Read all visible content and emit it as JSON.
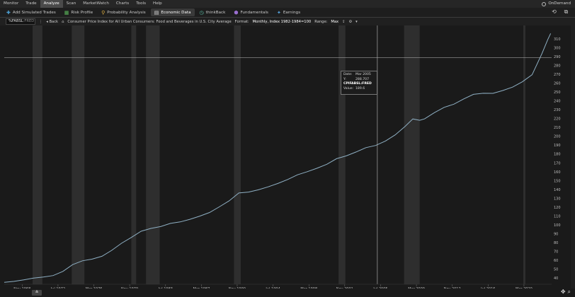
{
  "menu": {
    "items": [
      "Monitor",
      "Trade",
      "Analyze",
      "Scan",
      "MarketWatch",
      "Charts",
      "Tools",
      "Help"
    ],
    "active_index": 2,
    "ondemand_label": "OnDemand"
  },
  "tools": {
    "items": [
      {
        "label": "Add Simulated Trades",
        "icon": "plus-icon"
      },
      {
        "label": "Risk Profile",
        "icon": "risk-profile-icon"
      },
      {
        "label": "Probability Analysis",
        "icon": "probability-icon"
      },
      {
        "label": "Economic Data",
        "icon": "economic-data-icon"
      },
      {
        "label": "thinkBack",
        "icon": "thinkback-icon"
      },
      {
        "label": "Fundamentals",
        "icon": "fundamentals-icon"
      },
      {
        "label": "Earnings",
        "icon": "earnings-icon"
      }
    ],
    "active_index": 3
  },
  "chart_toolbar": {
    "symbol": "%FABSL",
    "symbol_suffix": ":FRED",
    "back_label": "Back",
    "series_title": "Consumer Price Index for All Urban Consumers: Food and Beverages in U.S. City Average",
    "format_label": "Format:",
    "format_value": "Monthly, Index 1982-1984=100",
    "range_label": "Range:",
    "range_value": "Max"
  },
  "tooltip": {
    "date_label": "Date:",
    "date_value": "Mar 2005",
    "y_label": "Y:",
    "y_value": "288.707",
    "symbol": "CPIFABSL:FRED",
    "value_label": "Value:",
    "value_value": "189.6"
  },
  "chart_data": {
    "type": "line",
    "title": "",
    "x_tick_labels": [
      "Nov 1968",
      "Jul 1972",
      "Mar 1976",
      "Nov 1979",
      "Jul 1983",
      "Mar 1987",
      "Nov 1990",
      "Jul 1994",
      "Mar 1998",
      "Nov 2001",
      "Jul 2005",
      "Mar 2009",
      "Nov 2012",
      "Jul 2016",
      "Mar 2020"
    ],
    "y_tick_labels": [
      40,
      50,
      60,
      70,
      80,
      90,
      100,
      110,
      120,
      130,
      140,
      150,
      160,
      170,
      180,
      190,
      200,
      210,
      220,
      230,
      240,
      250,
      260,
      270,
      280,
      290,
      300,
      310
    ],
    "ylim": [
      33,
      325
    ],
    "xlim": [
      1967.0,
      2023.0
    ],
    "crosshair": {
      "x": 2005.17,
      "y": 288.707
    },
    "recession_bands": [
      [
        1969.9,
        1970.9
      ],
      [
        1973.9,
        1975.2
      ],
      [
        1980.0,
        1980.5
      ],
      [
        1981.5,
        1982.9
      ],
      [
        1990.5,
        1991.2
      ],
      [
        2001.2,
        2001.9
      ],
      [
        2007.9,
        2009.5
      ],
      [
        2020.1,
        2020.3
      ]
    ],
    "series": [
      {
        "points": [
          [
            1967.0,
            35.2
          ],
          [
            1968.0,
            36.3
          ],
          [
            1969.0,
            38.0
          ],
          [
            1970.0,
            40.0
          ],
          [
            1971.0,
            41.2
          ],
          [
            1972.0,
            42.8
          ],
          [
            1973.0,
            47.5
          ],
          [
            1974.0,
            55.2
          ],
          [
            1975.0,
            59.5
          ],
          [
            1976.0,
            61.4
          ],
          [
            1977.0,
            64.6
          ],
          [
            1978.0,
            71.3
          ],
          [
            1979.0,
            79.3
          ],
          [
            1980.0,
            85.8
          ],
          [
            1981.0,
            92.8
          ],
          [
            1982.0,
            96.0
          ],
          [
            1983.0,
            98.1
          ],
          [
            1984.0,
            101.7
          ],
          [
            1985.0,
            103.4
          ],
          [
            1986.0,
            106.3
          ],
          [
            1987.0,
            109.9
          ],
          [
            1988.0,
            114.0
          ],
          [
            1989.0,
            120.4
          ],
          [
            1990.0,
            127.1
          ],
          [
            1991.0,
            136.0
          ],
          [
            1992.0,
            137.0
          ],
          [
            1993.0,
            139.6
          ],
          [
            1994.0,
            142.9
          ],
          [
            1995.0,
            146.8
          ],
          [
            1996.0,
            151.2
          ],
          [
            1997.0,
            156.5
          ],
          [
            1998.0,
            160.0
          ],
          [
            1999.0,
            163.9
          ],
          [
            2000.0,
            168.4
          ],
          [
            2001.0,
            174.7
          ],
          [
            2002.0,
            177.9
          ],
          [
            2003.0,
            182.3
          ],
          [
            2004.0,
            187.1
          ],
          [
            2005.0,
            189.6
          ],
          [
            2006.0,
            194.6
          ],
          [
            2007.0,
            201.6
          ],
          [
            2008.0,
            211.0
          ],
          [
            2008.8,
            219.5
          ],
          [
            2009.5,
            218.0
          ],
          [
            2010.0,
            219.6
          ],
          [
            2011.0,
            226.6
          ],
          [
            2012.0,
            232.6
          ],
          [
            2013.0,
            236.2
          ],
          [
            2014.0,
            242.1
          ],
          [
            2015.0,
            247.3
          ],
          [
            2016.0,
            248.5
          ],
          [
            2017.0,
            248.4
          ],
          [
            2018.0,
            251.6
          ],
          [
            2019.0,
            255.4
          ],
          [
            2020.0,
            261.4
          ],
          [
            2021.0,
            269.4
          ],
          [
            2022.0,
            293.0
          ],
          [
            2022.6,
            309.0
          ],
          [
            2022.9,
            316.0
          ]
        ]
      }
    ],
    "colors": {
      "line": "#8fb0c4",
      "grid": "#2a2a2a",
      "recession": "#2e2e2e",
      "crosshair": "#bcbcbc"
    }
  }
}
